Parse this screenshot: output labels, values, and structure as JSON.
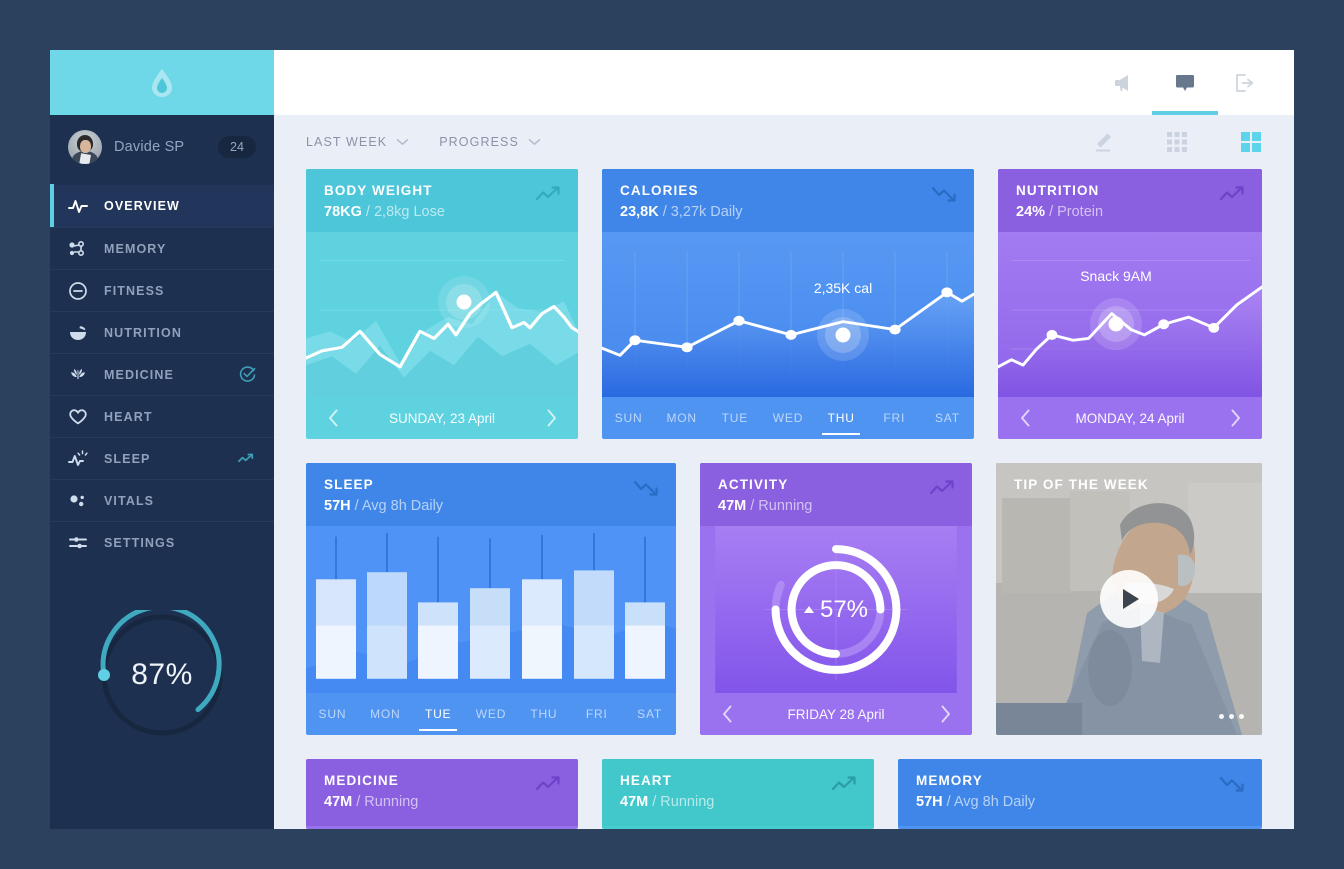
{
  "brand": {
    "logo_icon": "water-drop-icon",
    "logo_bg": "#6fd8e8"
  },
  "sidebar": {
    "profile": {
      "name": "Davide SP",
      "badge": "24",
      "avatar_icon": "user-avatar"
    },
    "items": [
      {
        "label": "OVERVIEW",
        "icon": "pulse-icon",
        "active": true,
        "trail": ""
      },
      {
        "label": "MEMORY",
        "icon": "molecule-icon",
        "active": false,
        "trail": ""
      },
      {
        "label": "FITNESS",
        "icon": "circle-minus-icon",
        "active": false,
        "trail": ""
      },
      {
        "label": "NUTRITION",
        "icon": "bowl-icon",
        "active": false,
        "trail": ""
      },
      {
        "label": "MEDICINE",
        "icon": "leaf-icon",
        "active": false,
        "trail": "check-circle-icon"
      },
      {
        "label": "HEART",
        "icon": "heart-icon",
        "active": false,
        "trail": ""
      },
      {
        "label": "SLEEP",
        "icon": "pulse-star-icon",
        "active": false,
        "trail": "trend-up-icon"
      },
      {
        "label": "VITALS",
        "icon": "dots-icon",
        "active": false,
        "trail": ""
      },
      {
        "label": "SETTINGS",
        "icon": "sliders-icon",
        "active": false,
        "trail": ""
      }
    ],
    "progress": {
      "value": "87%",
      "percent": 87,
      "track_color": "#17273f",
      "arc_color": "#3fa9bf",
      "knob_color": "#5ecfe4"
    }
  },
  "topbar": {
    "icons": [
      {
        "name": "megaphone-icon",
        "active": false
      },
      {
        "name": "chat-bubble-icon",
        "active": true
      },
      {
        "name": "logout-icon",
        "active": false
      }
    ],
    "active_underline_color": "#5ecfe4"
  },
  "filterbar": {
    "filters": [
      {
        "label": "LAST WEEK",
        "chevron": "chevron-down-icon"
      },
      {
        "label": "PROGRESS",
        "chevron": "chevron-down-icon"
      }
    ],
    "views": [
      {
        "name": "edit-pencil-icon",
        "active": false
      },
      {
        "name": "grid-list-icon",
        "active": false
      },
      {
        "name": "grid-cards-icon",
        "active": true
      }
    ],
    "active_view_color": "#5ecfe4"
  },
  "cards": {
    "body_weight": {
      "title": "BODY WEIGHT",
      "value": "78KG",
      "sub": "/ 2,8kg Lose",
      "trend": "trend-up-icon",
      "footer": "SUNDAY, 23 April",
      "prev_icon": "chevron-left-icon",
      "next_icon": "chevron-right-icon",
      "theme": "cyan"
    },
    "calories": {
      "title": "CALORIES",
      "value": "23,8K",
      "sub": "/ 3,27k Daily",
      "trend": "trend-down-icon",
      "point_label": "2,35K cal",
      "days": [
        "SUN",
        "MON",
        "TUE",
        "WED",
        "THU",
        "FRI",
        "SAT"
      ],
      "selected_day": "THU",
      "theme": "blue"
    },
    "nutrition": {
      "title": "NUTRITION",
      "value": "24%",
      "sub": "/ Protein",
      "trend": "trend-up-icon",
      "point_label": "Snack 9AM",
      "footer": "MONDAY, 24 April",
      "prev_icon": "chevron-left-icon",
      "next_icon": "chevron-right-icon",
      "theme": "purple"
    },
    "sleep": {
      "title": "SLEEP",
      "value": "57H",
      "sub": "/ Avg 8h Daily",
      "trend": "trend-down-icon",
      "days": [
        "SUN",
        "MON",
        "TUE",
        "WED",
        "THU",
        "FRI",
        "SAT"
      ],
      "selected_day": "TUE",
      "theme": "blue"
    },
    "activity": {
      "title": "ACTIVITY",
      "value": "47M",
      "sub": "/ Running",
      "trend": "trend-up-icon",
      "center_value": "57%",
      "center_arrow": "triangle-up-icon",
      "footer": "FRIDAY 28 April",
      "prev_icon": "chevron-left-icon",
      "next_icon": "chevron-right-icon",
      "theme": "purple"
    },
    "tip": {
      "title": "TIP OF THE WEEK",
      "play_icon": "play-icon",
      "menu_icon": "more-dots-icon"
    },
    "medicine": {
      "title": "MEDICINE",
      "value": "47M",
      "sub": "/ Running",
      "trend": "trend-up-icon",
      "theme": "purple"
    },
    "heart": {
      "title": "HEART",
      "value": "47M",
      "sub": "/ Running",
      "trend": "trend-up-icon",
      "theme": "teal"
    },
    "memory": {
      "title": "MEMORY",
      "value": "57H",
      "sub": "/ Avg 8h Daily",
      "trend": "trend-down-icon",
      "theme": "blue"
    }
  },
  "chart_data": [
    {
      "type": "line",
      "title": "BODY WEIGHT",
      "x": [
        0,
        1,
        2,
        3,
        4,
        5,
        6,
        7,
        8,
        9,
        10,
        11,
        12,
        13,
        14,
        15
      ],
      "values": [
        40,
        44,
        52,
        48,
        36,
        52,
        58,
        54,
        60,
        78,
        60,
        58,
        62,
        66,
        54,
        50
      ],
      "highlight_index": 9,
      "ylabel": "kg",
      "grid": true
    },
    {
      "type": "line",
      "title": "CALORIES",
      "categories": [
        "SUN",
        "MON",
        "TUE",
        "WED",
        "THU",
        "FRI",
        "SAT"
      ],
      "values": [
        2050,
        1950,
        2500,
        2180,
        2350,
        2100,
        2850
      ],
      "point_label": "2,35K cal",
      "highlight_index": 4,
      "ylabel": "cal",
      "grid": true
    },
    {
      "type": "line",
      "title": "NUTRITION",
      "x": [
        0,
        1,
        2,
        3,
        4,
        5,
        6,
        7,
        8,
        9
      ],
      "values": [
        14,
        20,
        18,
        38,
        34,
        36,
        68,
        52,
        58,
        56
      ],
      "point_label": "Snack 9AM",
      "highlight_index": 6,
      "ylabel": "%",
      "grid": true
    },
    {
      "type": "bar",
      "title": "SLEEP",
      "categories": [
        "SUN",
        "MON",
        "TUE",
        "WED",
        "THU",
        "FRI",
        "SAT"
      ],
      "values": [
        7.6,
        8.6,
        6.4,
        7.2,
        7.7,
        8.7,
        6.4
      ],
      "whisker_tops": [
        9.4,
        9.5,
        9.3,
        9.2,
        9.4,
        9.5,
        9.3
      ],
      "ylabel": "hours",
      "selected_index": 2
    },
    {
      "type": "pie",
      "title": "ACTIVITY",
      "series": [
        {
          "name": "outer",
          "value": 72
        },
        {
          "name": "inner",
          "value": 62
        }
      ],
      "center_value": "57%"
    }
  ]
}
